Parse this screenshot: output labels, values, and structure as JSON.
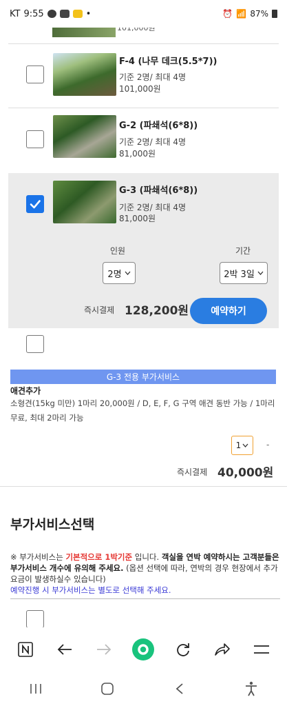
{
  "status_bar": {
    "carrier": "KT",
    "time": "9:55",
    "battery": "87%"
  },
  "peek_item": {
    "price_partial": "101,000원"
  },
  "rooms": [
    {
      "name": "F-4 (나무 데크(5.5*7))",
      "capacity": "기준 2명/ 최대 4명",
      "price": "101,000원",
      "checked": false
    },
    {
      "name": "G-2 (파쇄석(6*8))",
      "capacity": "기준 2명/ 최대 4명",
      "price": "81,000원",
      "checked": false
    },
    {
      "name": "G-3 (파쇄석(6*8))",
      "capacity": "기준 2명/ 최대 4명",
      "price": "81,000원",
      "checked": true
    }
  ],
  "selected_room": {
    "people_label": "인원",
    "people_value": "2명",
    "period_label": "기간",
    "period_value": "2박 3일",
    "pay_label": "즉시결제",
    "pay_amount": "128,200원",
    "book_button": "예약하기"
  },
  "addon": {
    "bar_title": "G-3 전용 부가서비스",
    "name": "애견추가",
    "description": "소형견(15kg 미만) 1마리 20,000원 / D, E, F, G 구역 애견 동반 가능 / 1마리 무료, 최대 2마리 가능",
    "qty_value": "1",
    "dash": "-",
    "pay_label": "즉시결제",
    "pay_amount": "40,000원"
  },
  "extra_section": {
    "title": "부가서비스선택",
    "notice_prefix": "※ 부가서비스는 ",
    "notice_red": "기본적으로 1박기준",
    "notice_mid": " 입니다. ",
    "notice_bold": "객실을 연박 예약하시는 고객분들은 부가서비스 개수에 유의해 주세요.",
    "notice_rest": " (옵션 선택에 따라, 연박의 경우 현장에서 추가요금이 발생하실수 있습니다)",
    "notice_blue": "예약진행 시 부가서비스는 별도로 선택해 주세요."
  },
  "browser_bar": {
    "icons": [
      "n-app-icon",
      "back-arrow-icon",
      "forward-arrow-icon",
      "home-green-icon",
      "reload-icon",
      "share-icon",
      "menu-icon"
    ]
  },
  "nav_bar": {
    "icons": [
      "recent-apps-icon",
      "home-icon",
      "back-icon",
      "accessibility-icon"
    ]
  },
  "colors": {
    "accent_blue": "#2a7de1",
    "checkbox_blue": "#1a73e8",
    "service_bar": "#6f96f0",
    "qty_border": "#f0a030",
    "notice_red": "#e53935",
    "notice_blue": "#3a3ad6",
    "green_icon": "#19c37d"
  }
}
